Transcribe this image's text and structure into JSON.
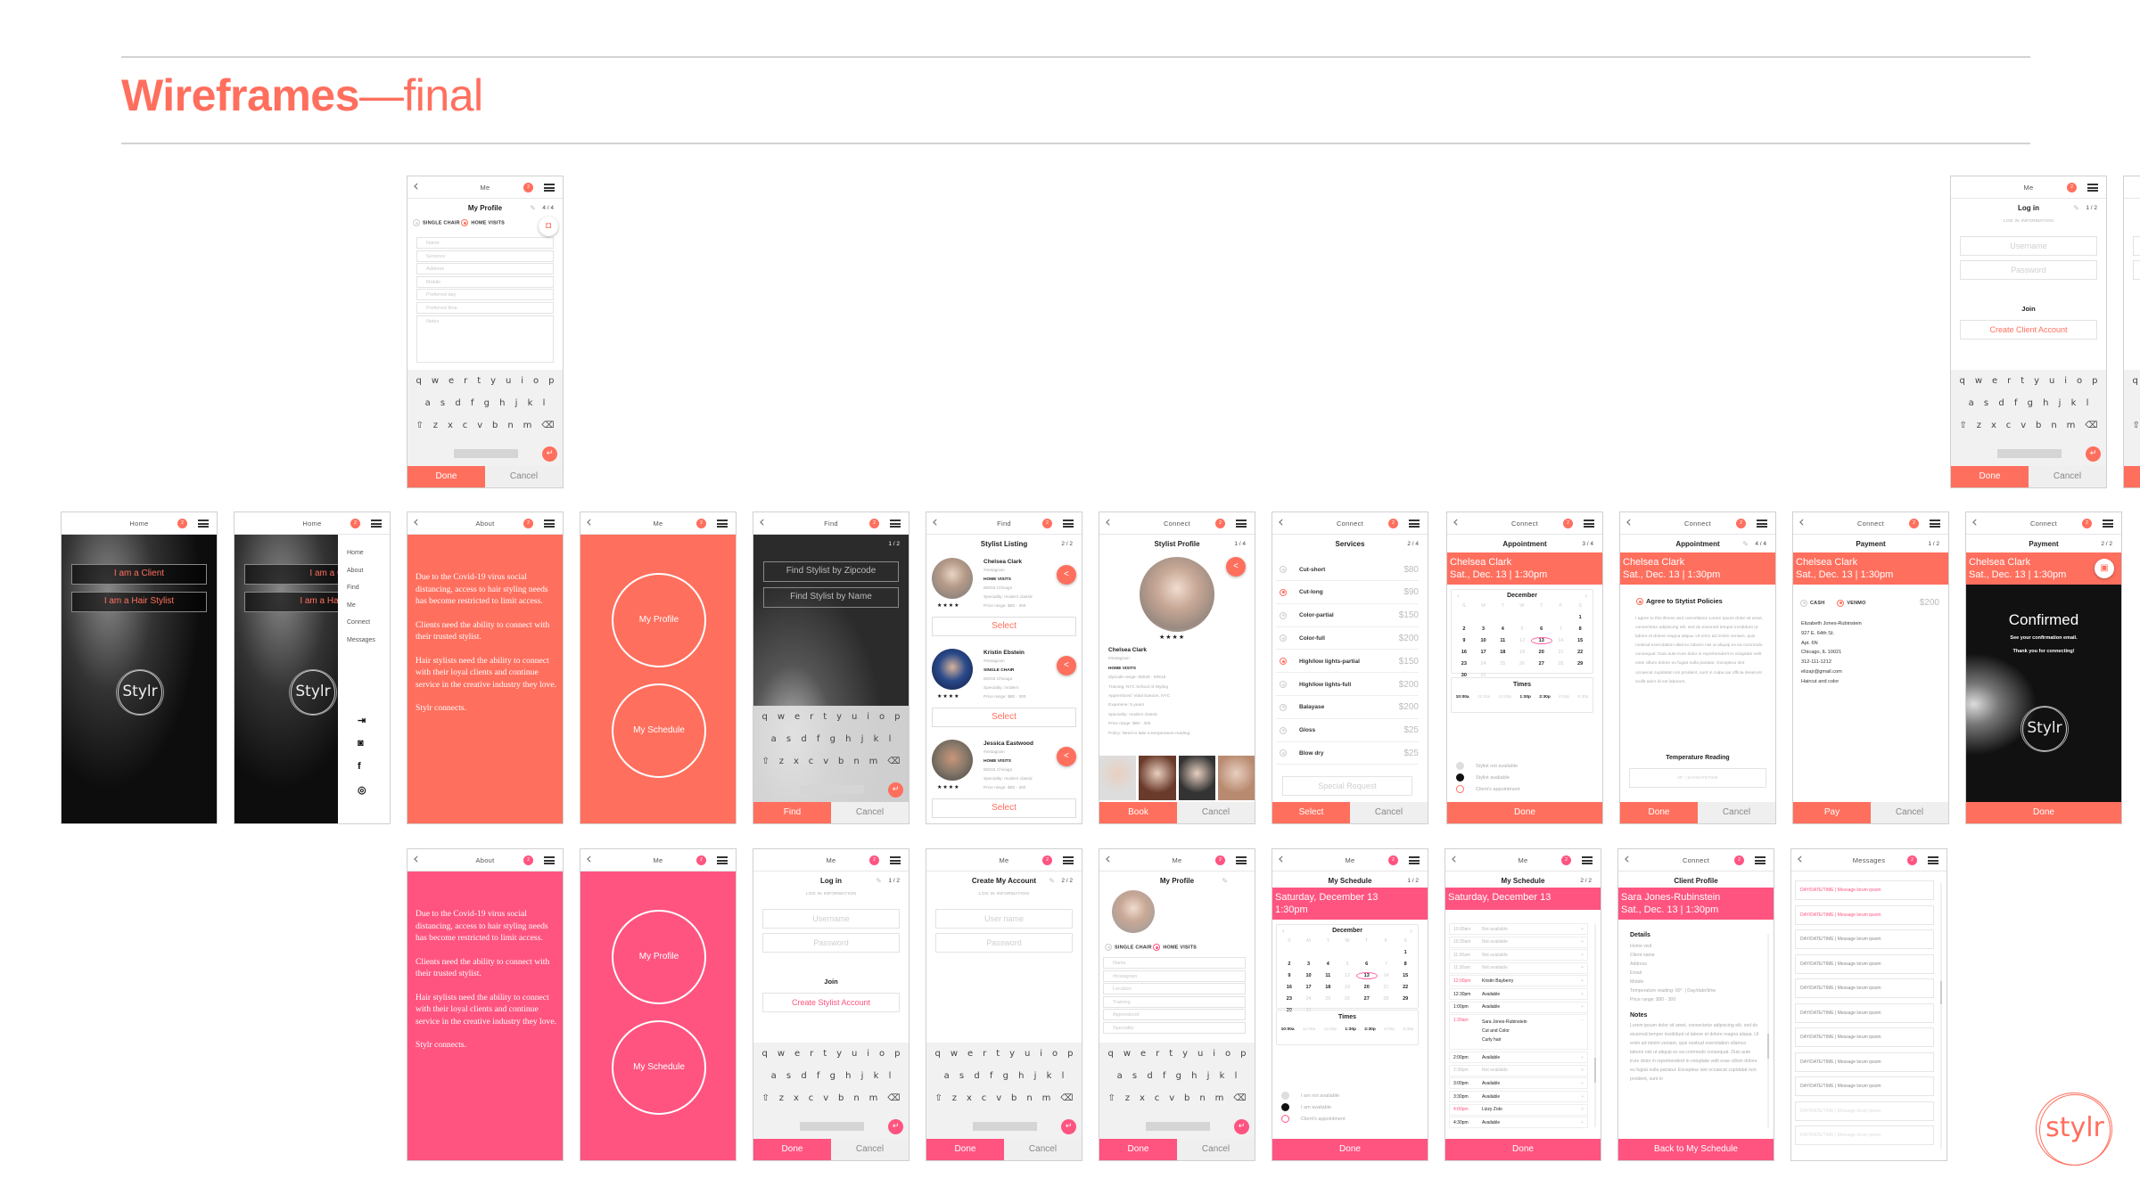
{
  "page": {
    "title_bold": "Wireframes",
    "title_thin": "—final",
    "logo_text": "stylr"
  },
  "colors": {
    "coral": "#ff6f5e",
    "pink": "#ff5480"
  },
  "common": {
    "badge_count": "2",
    "done": "Done",
    "cancel": "Cancel",
    "back_icon": "‹",
    "keyboard_rows": [
      [
        "q",
        "w",
        "e",
        "r",
        "t",
        "y",
        "u",
        "i",
        "o",
        "p"
      ],
      [
        "a",
        "s",
        "d",
        "f",
        "g",
        "h",
        "j",
        "k",
        "l"
      ],
      [
        "⇧",
        "z",
        "x",
        "c",
        "v",
        "b",
        "n",
        "m",
        "⌫"
      ]
    ],
    "enter_icon": "↵",
    "pencil_icon": "✎",
    "share_icon": "<",
    "stars": "★★★★",
    "brand": "Stylr"
  },
  "screens": {
    "client_profile_edit": {
      "nav": "Me",
      "title": "My Profile",
      "step": "4 / 4",
      "opt1": "SINGLE CHAIR",
      "opt2": "HOME VISITS",
      "fields": [
        "Name",
        "Services",
        "Address",
        "Mobile",
        "Preferred day",
        "Preferred time"
      ],
      "notes": "Notes"
    },
    "client_login": {
      "nav": "Me",
      "title": "Log in",
      "step": "1 / 2",
      "section": "LOG IN INFORMATION",
      "username": "Username",
      "password": "Password",
      "join": "Join",
      "create": "Create Client Account"
    },
    "client_create": {
      "nav": "Me",
      "title": "Create My Account",
      "step": "2 / 2",
      "section": "LOG IN INFORMATION",
      "username": "User name",
      "password": "Password"
    },
    "messages": {
      "nav": "Messages",
      "item": "DAY/DATE/TIME   |   Message lorum ipsom",
      "count": 11,
      "highlighted": 2,
      "faded": 2
    },
    "home": {
      "nav": "Home",
      "client_btn": "I am a Client",
      "stylist_btn": "I am a Hair Stylist"
    },
    "home_menu": {
      "nav": "Home",
      "items": [
        "Home",
        "About",
        "Find",
        "Me",
        "Connect",
        "Messages"
      ],
      "icons": [
        "login-icon",
        "camera-icon",
        "facebook-icon",
        "instagram-icon"
      ]
    },
    "about": {
      "nav": "About",
      "paragraphs": [
        "Due to the Covid-19 virus social distancing, access to hair styling needs has become restricted to limit access.",
        "Clients need the ability to connect with their trusted stylist.",
        "Hair stylists need the ability to connect with their loyal clients and continue service in the creative industry they love.",
        "Stylr connects."
      ]
    },
    "me": {
      "nav": "Me",
      "profile": "My Profile",
      "schedule": "My Schedule"
    },
    "find": {
      "nav": "Find",
      "step": "1 / 2",
      "zip": "Find Stylist by Zipcode",
      "name": "Find Stylist by Name",
      "find": "Find"
    },
    "listing": {
      "nav": "Find",
      "title": "Stylist Listing",
      "step": "2 / 2",
      "select": "Select",
      "stylists": [
        {
          "name": "Chelsea Clark",
          "ig": "#instagram",
          "type": "HOME VISITS",
          "loc": "60015 Chicago",
          "spec": "Speciality: modern classic",
          "price": "Price range: $80 - 300"
        },
        {
          "name": "Kristin Ebstein",
          "ig": "#instagram",
          "type": "SINGLE CHAIR",
          "loc": "60015 Chicago",
          "spec": "Speciality: modern",
          "price": "Price range: $80 - 300"
        },
        {
          "name": "Jessica Eastwood",
          "ig": "#instagram",
          "type": "HOME VISITS",
          "loc": "60015 Chicago",
          "spec": "Speciality: modern classic",
          "price": "Price range: $80 - 300"
        }
      ]
    },
    "stylist_profile": {
      "nav": "Connect",
      "title": "Stylist Profile",
      "step": "1 / 4",
      "name": "Chelsea Clark",
      "ig": "#instagram",
      "type": "HOME VISITS",
      "details": [
        "Zipcode range: 60026 - 60616",
        "Training: NYC School of Styling",
        "Apprenticed: Vidal Sasoon, NYC",
        "Experiene: 5 years",
        "Speciality: modern classic",
        "Price range: $80 - 300",
        "Policy: Need to take a temperature reading."
      ],
      "book": "Book"
    },
    "services": {
      "nav": "Connect",
      "title": "Services",
      "step": "2 / 4",
      "select": "Select",
      "special": "Special Request",
      "items": [
        {
          "name": "Cut-short",
          "price": "$80",
          "on": false
        },
        {
          "name": "Cut-long",
          "price": "$90",
          "on": true
        },
        {
          "name": "Color-partial",
          "price": "$150",
          "on": false
        },
        {
          "name": "Color-full",
          "price": "$200",
          "on": false
        },
        {
          "name": "High/low lights-partial",
          "price": "$150",
          "on": true
        },
        {
          "name": "High/low lights-full",
          "price": "$200",
          "on": false
        },
        {
          "name": "Balayase",
          "price": "$200",
          "on": false
        },
        {
          "name": "Gloss",
          "price": "$25",
          "on": false
        },
        {
          "name": "Blow dry",
          "price": "$25",
          "on": false
        }
      ]
    },
    "appointment_cal": {
      "nav": "Connect",
      "title": "Appointment",
      "step": "3 / 4",
      "banner1": "Chelsea Clark",
      "banner2": "Sat., Dec. 13  |  1:30pm",
      "month": "December",
      "times_label": "Times",
      "legend": [
        "Stylist not available",
        "Stylist available",
        "Client's appointment"
      ]
    },
    "appointment_policy": {
      "nav": "Connect",
      "title": "Appointment",
      "step": "4 / 4",
      "banner1": "Chelsea Clark",
      "banner2": "Sat., Dec. 13  |  1:30pm",
      "agree": "Agree to Stytist Policies",
      "policy": "I agree to this illness and cancellation Lorem ipsum dolor sit amet, consectetur adipiscing elit, sed do eiusmod tempor incididunt ut labore et dolore magna aliqua. Ut enim ad minim veniam, quis nostrud exercitation ullamco laboris nisi ut aliquip ex ea commodo consequat. Duis aute irure dolor in reprehenderit in voluptate velit esse cillum dolore eu fugiat nulla pariatur. Excepteur sint occaecat cupidatat non proident, sunt in culpa qui officia deserunt mollit anim id est laborum.",
      "temp_label": "Temperature Reading",
      "temp_field": "00°.   |   DAY/DATE/TIME"
    },
    "payment": {
      "nav": "Connect",
      "title": "Payment",
      "step": "1 / 2",
      "banner1": "Chelsea Clark",
      "banner2": "Sat., Dec. 13  |  1:30pm",
      "cash": "CASH",
      "venmo": "VENMO",
      "amount": "$200",
      "address": [
        "Elizabeth Jones-Rubinstein",
        "927 E. 64th St.",
        "Apt. 6N",
        "Chicago, IL 10021",
        "312-111-1212",
        "elizajr@gmail.com",
        "Haircut and color"
      ],
      "pay": "Pay"
    },
    "confirmed": {
      "nav": "Connect",
      "title": "Payment",
      "step": "2 / 2",
      "banner1": "Chelsea Clark",
      "banner2": "Sat., Dec. 13  |  1:30pm",
      "heading": "Confirmed",
      "line1": "See your confirmation email.",
      "line2": "Thank you for connecting!"
    },
    "stylist_login": {
      "nav": "Me",
      "title": "Log in",
      "step": "1 / 2",
      "section": "LOG IN INFORMATION",
      "username": "Username",
      "password": "Password",
      "join": "Join",
      "create": "Create Stylist Account"
    },
    "stylist_profile_edit": {
      "nav": "Me",
      "title": "My Profile",
      "opt1": "SINGLE CHAIR",
      "opt2": "HOME VISITS",
      "fields": [
        "Name",
        "#instagram",
        "Location",
        "Training",
        "Apprenticed",
        "Speciality"
      ]
    },
    "my_schedule_cal": {
      "nav": "Me",
      "title": "My Schedule",
      "step": "1 / 2",
      "banner1": "Saturday, December 13",
      "banner2": "1:30pm",
      "month": "December",
      "times_label": "Times",
      "legend": [
        "I am not available",
        "I am available",
        "Client's appointment"
      ]
    },
    "my_schedule_list": {
      "nav": "Me",
      "title": "My Schedule",
      "step": "2 / 2",
      "banner1": "Saturday, December 13",
      "rows": [
        {
          "time": "10:00am",
          "label": "Not available",
          "kind": "na"
        },
        {
          "time": "10:30am",
          "label": "Not available",
          "kind": "na"
        },
        {
          "time": "11:00am",
          "label": "Not available",
          "kind": "na"
        },
        {
          "time": "11:30am",
          "label": "Not available",
          "kind": "na"
        },
        {
          "time": "12:00pm",
          "label": "Kristin Bayberry",
          "kind": "bk"
        },
        {
          "time": "12:30pm",
          "label": "Available",
          "kind": "av"
        },
        {
          "time": "1:00pm",
          "label": "Available",
          "kind": "av"
        },
        {
          "time": "1:30am",
          "label": "Sara Jones-Rubinstein / Cut and Color / Curly hair",
          "kind": "bk"
        },
        {
          "time": "2:00pm",
          "label": "Available",
          "kind": "av"
        },
        {
          "time": "2:30pm",
          "label": "Not available",
          "kind": "na"
        },
        {
          "time": "3:00pm",
          "label": "Available",
          "kind": "av"
        },
        {
          "time": "3:30pm",
          "label": "Available",
          "kind": "av"
        },
        {
          "time": "4:00pm",
          "label": "Lizzy Zoto",
          "kind": "bk"
        },
        {
          "time": "4:30pm",
          "label": "Available",
          "kind": "av"
        }
      ]
    },
    "client_profile": {
      "nav": "Connect",
      "title": "Client Profile",
      "banner1": "Sara Jones-Rubinstein",
      "banner2": "Sat., Dec. 13  |  1:30pm",
      "details_label": "Details",
      "details": [
        "Home visit",
        "Client name",
        "Address",
        "Email",
        "Mobile",
        "Temperature reading: 00°.  |  Day/date/time",
        "Price range: $80 - 300"
      ],
      "notes_label": "Notes",
      "notes": "Lorem ipsum dolor sit amet, consectetur adipiscing elit, sed do eiusmod tempor incididunt ut labore et dolore magna aliqua. Ut enim ad minim veniam, quis nostrud exercitation ullamco laboris nisi ut aliquip ex ea commodo consequat. Duis aute irure dolor in reprehenderit in voluptate velit esse cillum dolore eu fugiat nulla pariatur. Excepteur sint occaecat cupidatat non proident, sunt in",
      "back": "Back to My Schedule"
    }
  },
  "calendar": {
    "weekdays": [
      "S",
      "M",
      "T",
      "W",
      "T",
      "F",
      "S"
    ],
    "days": [
      {
        "d": "",
        "k": ""
      },
      {
        "d": "",
        "k": ""
      },
      {
        "d": "",
        "k": ""
      },
      {
        "d": "",
        "k": ""
      },
      {
        "d": "",
        "k": ""
      },
      {
        "d": "",
        "k": ""
      },
      {
        "d": "1",
        "k": "b"
      },
      {
        "d": "2",
        "k": "b"
      },
      {
        "d": "3",
        "k": "b"
      },
      {
        "d": "4",
        "k": "b"
      },
      {
        "d": "5",
        "k": "l"
      },
      {
        "d": "6",
        "k": "b"
      },
      {
        "d": "7",
        "k": "l"
      },
      {
        "d": "8",
        "k": "b"
      },
      {
        "d": "9",
        "k": "b"
      },
      {
        "d": "10",
        "k": "b"
      },
      {
        "d": "11",
        "k": "b"
      },
      {
        "d": "12",
        "k": "l"
      },
      {
        "d": "13",
        "k": "b sel"
      },
      {
        "d": "14",
        "k": "l"
      },
      {
        "d": "15",
        "k": "b"
      },
      {
        "d": "16",
        "k": "b"
      },
      {
        "d": "17",
        "k": "b"
      },
      {
        "d": "18",
        "k": "b"
      },
      {
        "d": "19",
        "k": "l"
      },
      {
        "d": "20",
        "k": "b"
      },
      {
        "d": "21",
        "k": "l"
      },
      {
        "d": "22",
        "k": "b"
      },
      {
        "d": "23",
        "k": "b"
      },
      {
        "d": "24",
        "k": "l"
      },
      {
        "d": "25",
        "k": "l"
      },
      {
        "d": "26",
        "k": "l"
      },
      {
        "d": "27",
        "k": "b"
      },
      {
        "d": "28",
        "k": "l"
      },
      {
        "d": "29",
        "k": "b"
      },
      {
        "d": "30",
        "k": "b"
      },
      {
        "d": "31",
        "k": "l"
      }
    ],
    "times": [
      {
        "t": "10:00a",
        "k": "b"
      },
      {
        "t": "11:00a",
        "k": "l"
      },
      {
        "t": "12:00p",
        "k": "l"
      },
      {
        "t": "1:30p",
        "k": "b sel"
      },
      {
        "t": "2:30p",
        "k": "b"
      },
      {
        "t": "4:00p",
        "k": "l"
      },
      {
        "t": "5:30p",
        "k": "l"
      }
    ]
  }
}
